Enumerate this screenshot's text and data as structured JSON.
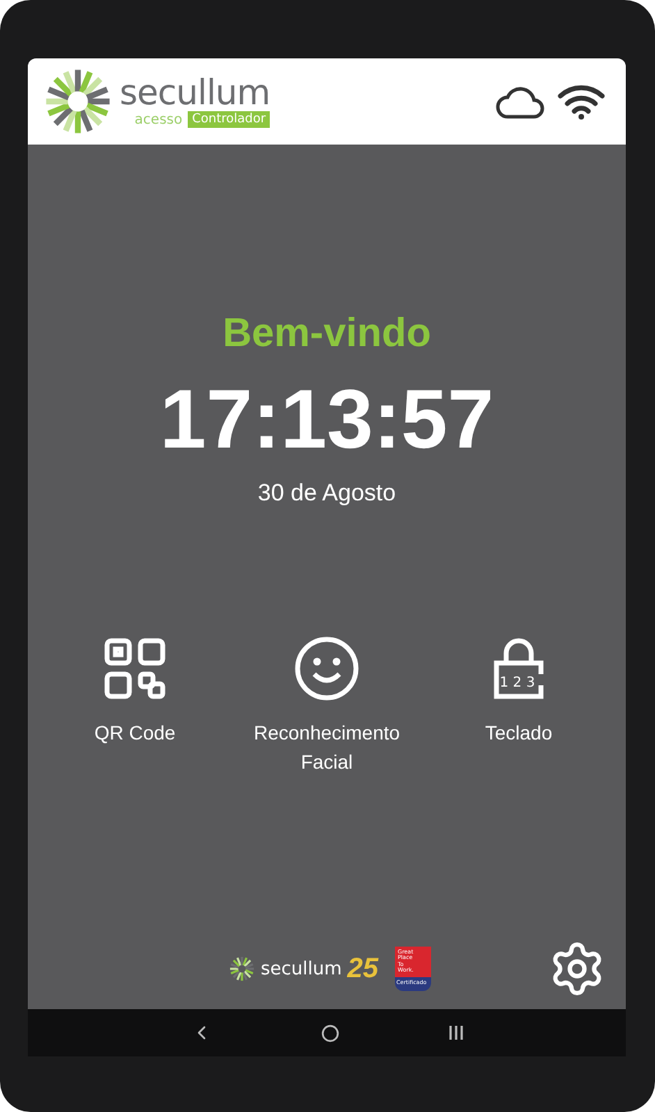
{
  "header": {
    "brand": "secullum",
    "product": "acesso",
    "edition": "Controlador",
    "cloud_connected": true,
    "wifi_connected": true
  },
  "welcome": "Bem-vindo",
  "time": "17:13:57",
  "date": "30 de Agosto",
  "actions": [
    {
      "kind": "qr",
      "label": "QR Code"
    },
    {
      "kind": "face",
      "label": "Reconhecimento Facial"
    },
    {
      "kind": "keypad",
      "label": "Teclado",
      "icon_text": "1 2 3"
    }
  ],
  "footer": {
    "brand": "secullum",
    "anniversary": "25",
    "badge": [
      "Great",
      "Place",
      "To",
      "Work.",
      "Certificado"
    ]
  }
}
